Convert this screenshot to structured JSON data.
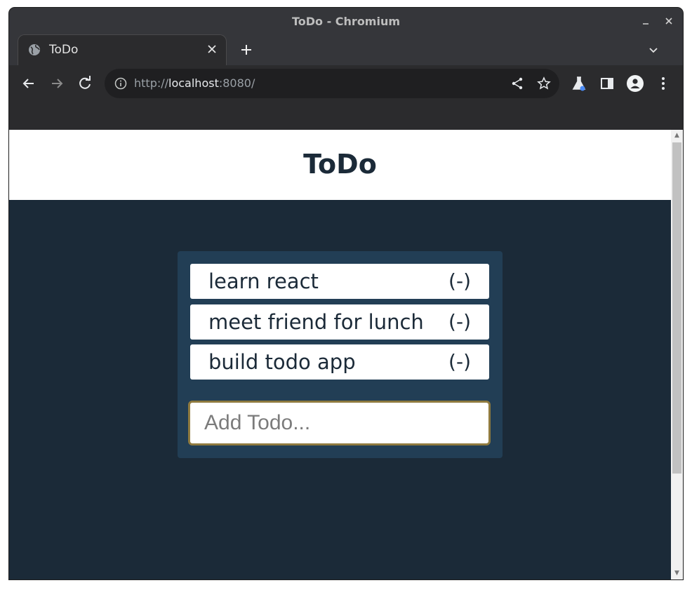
{
  "window": {
    "title": "ToDo - Chromium",
    "minimize_icon": "minimize-icon",
    "close_icon": "close-icon"
  },
  "tab": {
    "title": "ToDo",
    "favicon": "globe-icon",
    "close_label": "✕"
  },
  "toolbar": {
    "url_scheme": "http://",
    "url_host": "localhost",
    "url_rest": ":8080/"
  },
  "app": {
    "title": "ToDo",
    "todos": [
      {
        "text": "learn react",
        "remove_label": "(-)"
      },
      {
        "text": "meet friend for lunch",
        "remove_label": "(-)"
      },
      {
        "text": "build todo app",
        "remove_label": "(-)"
      }
    ],
    "input": {
      "placeholder": "Add Todo...",
      "value": ""
    }
  },
  "colors": {
    "page_bg": "#1b2a38",
    "panel_bg": "#223e55",
    "input_border": "#8f7a3f",
    "chrome_dark": "#35363a"
  }
}
